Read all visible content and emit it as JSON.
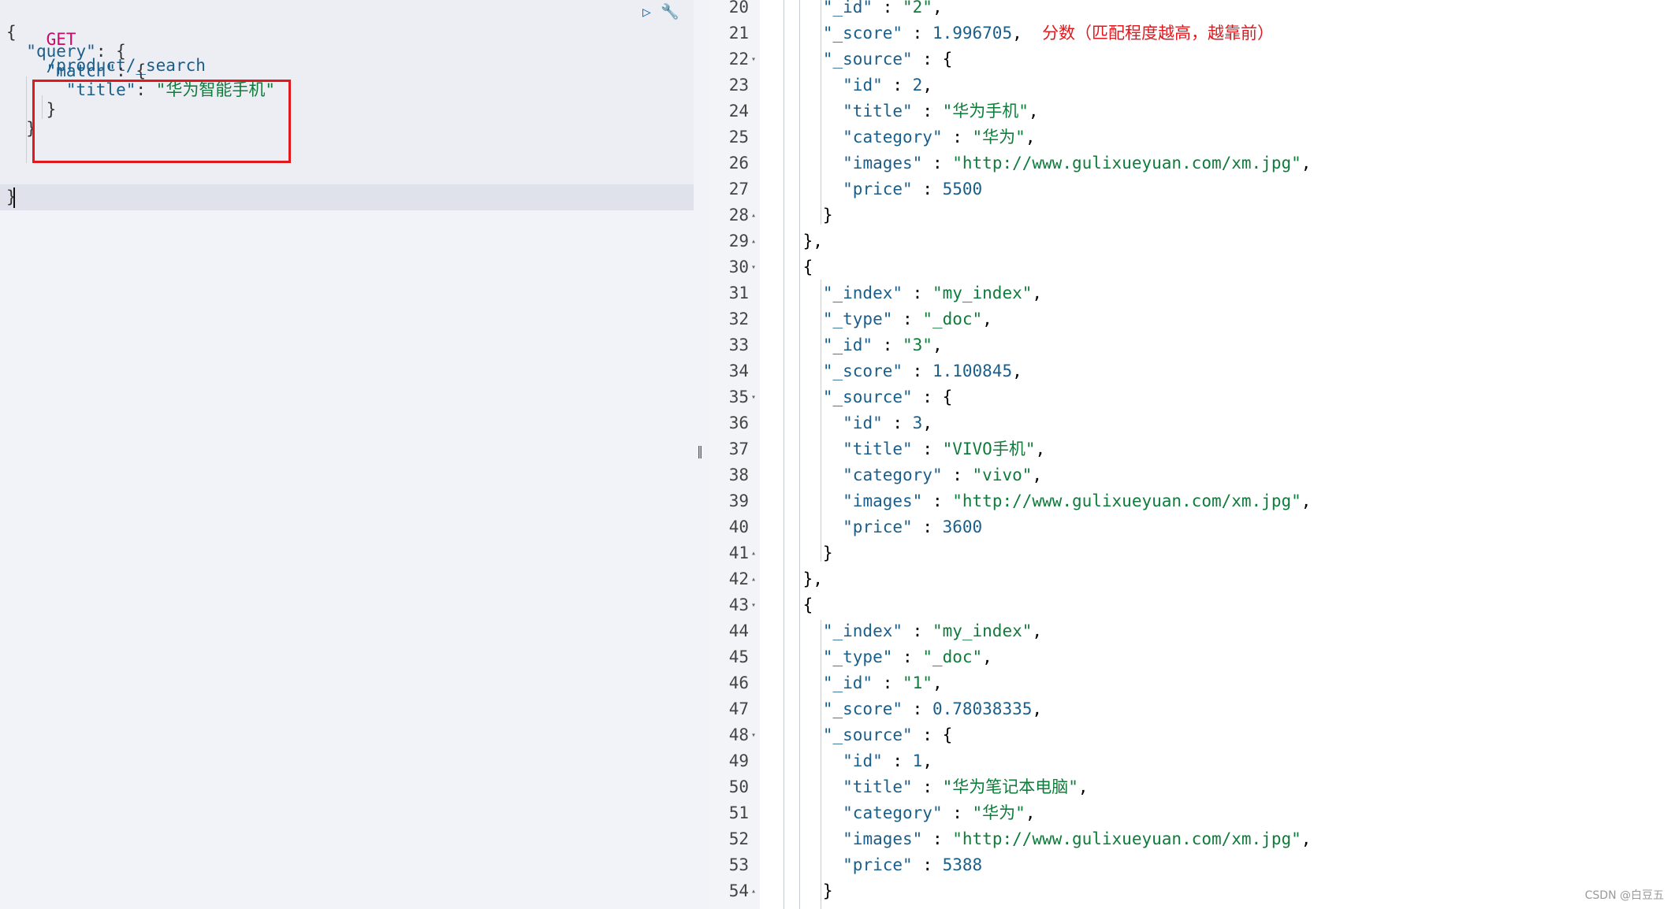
{
  "request": {
    "verb": "GET",
    "path": "/product/_search",
    "lines": [
      [
        "{"
      ],
      [
        "  ",
        "\"query\"",
        ": {"
      ],
      [
        "    ",
        "\"match\"",
        ": {"
      ],
      [
        "      ",
        "\"title\"",
        ": ",
        "\"华为智能手机\""
      ],
      [
        "    }"
      ],
      [
        "  }"
      ],
      [
        "}"
      ]
    ]
  },
  "response": {
    "lines": [
      {
        "n": "20",
        "fold": "",
        "text": "      \"_id\" : \"2\","
      },
      {
        "n": "21",
        "fold": "",
        "text": "      \"_score\" : 1.996705,",
        "note": "分数（匹配程度越高，越靠前）"
      },
      {
        "n": "22",
        "fold": "▾",
        "text": "      \"_source\" : {"
      },
      {
        "n": "23",
        "fold": "",
        "text": "        \"id\" : 2,"
      },
      {
        "n": "24",
        "fold": "",
        "text": "        \"title\" : \"华为手机\","
      },
      {
        "n": "25",
        "fold": "",
        "text": "        \"category\" : \"华为\","
      },
      {
        "n": "26",
        "fold": "",
        "text": "        \"images\" : \"http://www.gulixueyuan.com/xm.jpg\","
      },
      {
        "n": "27",
        "fold": "",
        "text": "        \"price\" : 5500"
      },
      {
        "n": "28",
        "fold": "▴",
        "text": "      }"
      },
      {
        "n": "29",
        "fold": "▴",
        "text": "    },"
      },
      {
        "n": "30",
        "fold": "▾",
        "text": "    {"
      },
      {
        "n": "31",
        "fold": "",
        "text": "      \"_index\" : \"my_index\","
      },
      {
        "n": "32",
        "fold": "",
        "text": "      \"_type\" : \"_doc\","
      },
      {
        "n": "33",
        "fold": "",
        "text": "      \"_id\" : \"3\","
      },
      {
        "n": "34",
        "fold": "",
        "text": "      \"_score\" : 1.100845,"
      },
      {
        "n": "35",
        "fold": "▾",
        "text": "      \"_source\" : {"
      },
      {
        "n": "36",
        "fold": "",
        "text": "        \"id\" : 3,"
      },
      {
        "n": "37",
        "fold": "",
        "text": "        \"title\" : \"VIVO手机\","
      },
      {
        "n": "38",
        "fold": "",
        "text": "        \"category\" : \"vivo\","
      },
      {
        "n": "39",
        "fold": "",
        "text": "        \"images\" : \"http://www.gulixueyuan.com/xm.jpg\","
      },
      {
        "n": "40",
        "fold": "",
        "text": "        \"price\" : 3600"
      },
      {
        "n": "41",
        "fold": "▴",
        "text": "      }"
      },
      {
        "n": "42",
        "fold": "▴",
        "text": "    },"
      },
      {
        "n": "43",
        "fold": "▾",
        "text": "    {"
      },
      {
        "n": "44",
        "fold": "",
        "text": "      \"_index\" : \"my_index\","
      },
      {
        "n": "45",
        "fold": "",
        "text": "      \"_type\" : \"_doc\","
      },
      {
        "n": "46",
        "fold": "",
        "text": "      \"_id\" : \"1\","
      },
      {
        "n": "47",
        "fold": "",
        "text": "      \"_score\" : 0.78038335,"
      },
      {
        "n": "48",
        "fold": "▾",
        "text": "      \"_source\" : {"
      },
      {
        "n": "49",
        "fold": "",
        "text": "        \"id\" : 1,"
      },
      {
        "n": "50",
        "fold": "",
        "text": "        \"title\" : \"华为笔记本电脑\","
      },
      {
        "n": "51",
        "fold": "",
        "text": "        \"category\" : \"华为\","
      },
      {
        "n": "52",
        "fold": "",
        "text": "        \"images\" : \"http://www.gulixueyuan.com/xm.jpg\","
      },
      {
        "n": "53",
        "fold": "",
        "text": "        \"price\" : 5388"
      },
      {
        "n": "54",
        "fold": "▴",
        "text": "      }"
      }
    ]
  },
  "icons": {
    "run": "play-icon",
    "settings": "wrench-icon"
  },
  "splitter_glyph": "‖",
  "watermark": "CSDN @白豆五",
  "colors": {
    "highlight": "#e0191f",
    "verb": "#c80a68",
    "key": "#1a5e8a",
    "string": "#0e7c3a"
  }
}
